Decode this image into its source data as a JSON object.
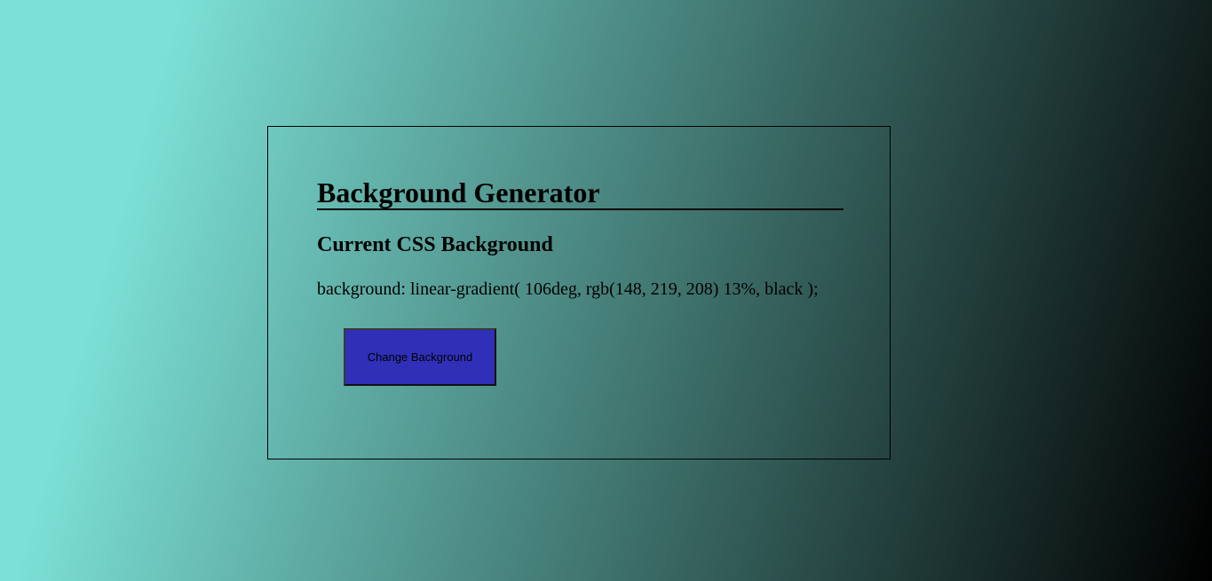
{
  "app": {
    "title": "Background Generator",
    "subtitle": "Current CSS Background",
    "css_text": "background: linear-gradient( 106deg, rgb(148, 219, 208) 13%, black );",
    "button_label": "Change Background"
  },
  "colors": {
    "gradient_start": "#7ce0d6",
    "gradient_end": "#000000",
    "button_background": "#2f2fb8"
  }
}
